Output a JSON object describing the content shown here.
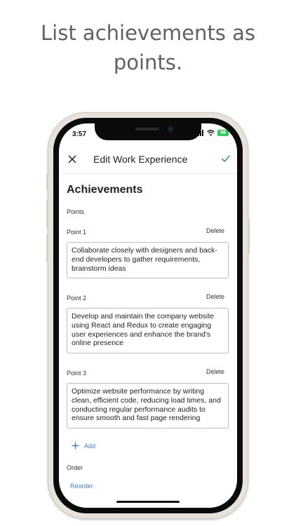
{
  "promo": {
    "line1": "List achievements as",
    "line2": "points."
  },
  "status": {
    "time": "3:57",
    "battery": "98"
  },
  "appbar": {
    "title": "Edit Work Experience"
  },
  "section": {
    "title": "Achievements",
    "points_label": "Points"
  },
  "points": [
    {
      "label": "Point 1",
      "delete": "Delete",
      "text": "Collaborate closely with designers and back-end developers to gather requirements, brainstorm ideas"
    },
    {
      "label": "Point 2",
      "delete": "Delete",
      "text": "Develop and maintain the company website using React and Redux to create engaging user experiences and enhance the brand's online presence"
    },
    {
      "label": "Point 3",
      "delete": "Delete",
      "text": "Optimize website performance by writing clean, efficient code, reducing load times, and conducting regular performance audits to ensure smooth and fast page rendering"
    }
  ],
  "add": {
    "label": "Add"
  },
  "order": {
    "label": "Order",
    "reorder": "Reorder"
  },
  "colors": {
    "accent": "#3b7fd6",
    "check": "#2e9e5a",
    "promo_text": "#5f6166"
  },
  "icons": {
    "close": "close-icon",
    "confirm": "check-icon",
    "add": "plus-icon",
    "signal": "signal-icon",
    "wifi": "wifi-icon",
    "battery": "battery-icon"
  }
}
